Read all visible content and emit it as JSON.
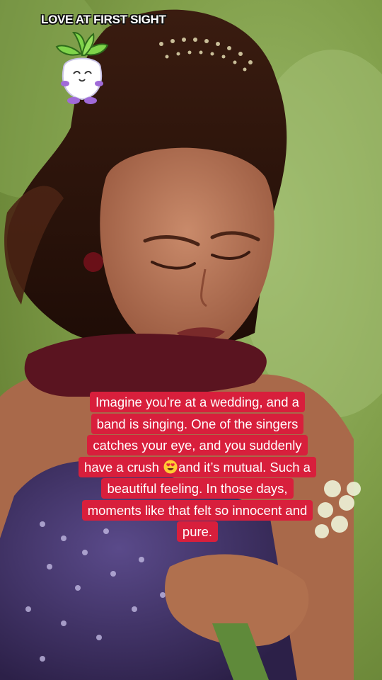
{
  "video": {
    "watermark_title": "LOVE AT FIRST SIGHT",
    "mascot_icon": "sprout-mascot-icon",
    "background": "woman-in-purple-sequin-dress-holding-flowers"
  },
  "caption": {
    "text_before_emoji": "Imagine you’re at a wedding, and a band is singing. One of the singers catches your eye, and you suddenly have a crush ",
    "emoji": "heart-eyes-emoji",
    "text_after_emoji": "and it’s mutual. Such a beautiful feeling. In those days, moments like that felt so innocent and pure.",
    "highlight_color": "#d81f3c",
    "text_color": "#ffffff"
  }
}
